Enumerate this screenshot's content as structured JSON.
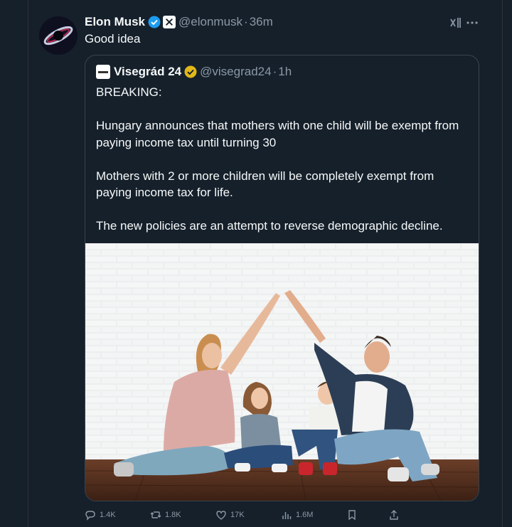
{
  "tweet": {
    "author": {
      "display_name": "Elon Musk",
      "handle": "@elonmusk",
      "time": "36m",
      "separator": "·"
    },
    "text": "Good idea",
    "icons": {
      "verified": "verified-badge-icon",
      "affiliate": "x-logo-icon",
      "grok": "grok-icon",
      "more": "more-icon"
    }
  },
  "quote": {
    "author": {
      "display_name": "Visegrád 24",
      "handle": "@visegrad24",
      "time": "1h",
      "separator": "·"
    },
    "paragraphs": [
      "BREAKING:",
      "Hungary announces that mothers with one child will be exempt from paying income tax until turning 30",
      "Mothers with 2 or more children will be completely exempt from paying income tax for life.",
      "The new policies are an attempt to reverse demographic decline."
    ],
    "image": "photo-family-house-gesture"
  },
  "actions": {
    "replies": "1.4K",
    "reposts": "1.8K",
    "likes": "17K",
    "views": "1.6M",
    "icons": [
      "reply-icon",
      "repost-icon",
      "like-icon",
      "views-icon",
      "bookmark-icon",
      "share-icon"
    ]
  },
  "colors": {
    "background": "#15202b",
    "text": "#f7f9f9",
    "muted": "#8b98a5",
    "border": "#38444d",
    "verified_blue": "#1d9bf0",
    "verified_gold": "#e2b719"
  }
}
